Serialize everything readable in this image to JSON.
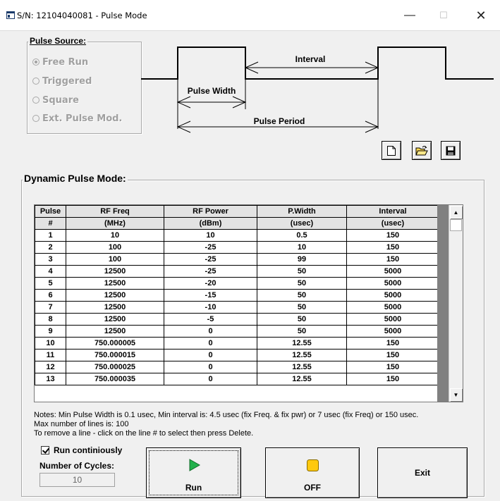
{
  "window": {
    "title": "S/N: 12104040081 - Pulse Mode",
    "minimize": "—",
    "maximize": "☐",
    "close": "✕"
  },
  "pulse_source": {
    "legend": "Pulse Source:",
    "options": [
      "Free Run",
      "Triggered",
      "Square",
      "Ext. Pulse Mod."
    ],
    "selected": "Free Run"
  },
  "diagram": {
    "interval": "Interval",
    "pulse_width": "Pulse Width",
    "pulse_period": "Pulse Period"
  },
  "toolbar": {
    "new_icon": "new-file-icon",
    "open_icon": "open-folder-icon",
    "save_icon": "save-disk-icon"
  },
  "dynamic": {
    "legend": "Dynamic Pulse Mode:"
  },
  "table": {
    "headers": [
      "Pulse",
      "RF Freq",
      "RF Power",
      "P.Width",
      "Interval"
    ],
    "units": [
      "#",
      "(MHz)",
      "(dBm)",
      "(usec)",
      "(usec)"
    ],
    "rows": [
      [
        "1",
        "10",
        "10",
        "0.5",
        "150"
      ],
      [
        "2",
        "100",
        "-25",
        "10",
        "150"
      ],
      [
        "3",
        "100",
        "-25",
        "99",
        "150"
      ],
      [
        "4",
        "12500",
        "-25",
        "50",
        "5000"
      ],
      [
        "5",
        "12500",
        "-20",
        "50",
        "5000"
      ],
      [
        "6",
        "12500",
        "-15",
        "50",
        "5000"
      ],
      [
        "7",
        "12500",
        "-10",
        "50",
        "5000"
      ],
      [
        "8",
        "12500",
        "-5",
        "50",
        "5000"
      ],
      [
        "9",
        "12500",
        "0",
        "50",
        "5000"
      ],
      [
        "10",
        "750.000005",
        "0",
        "12.55",
        "150"
      ],
      [
        "11",
        "750.000015",
        "0",
        "12.55",
        "150"
      ],
      [
        "12",
        "750.000025",
        "0",
        "12.55",
        "150"
      ],
      [
        "13",
        "750.000035",
        "0",
        "12.55",
        "150"
      ]
    ]
  },
  "notes": {
    "line1": "Notes: Min Pulse Width is 0.1 usec, Min interval is: 4.5 usec (fix Freq. & fix pwr) or 7 usec (fix Freq) or 150 usec.",
    "line2": "Max number of lines is: 100",
    "line3": "To remove a line - click on the line # to select then press Delete."
  },
  "controls": {
    "run_continuously_label": "Run continiously",
    "run_continuously_checked": true,
    "cycles_label": "Number of Cycles:",
    "cycles_value": "10",
    "run_label": "Run",
    "off_label": "OFF",
    "exit_label": "Exit"
  },
  "colors": {
    "run_icon": "#22b14c",
    "off_icon": "#ffc90e",
    "grid_header": "#e3e3e3",
    "window_bg": "#f0f0f0"
  }
}
